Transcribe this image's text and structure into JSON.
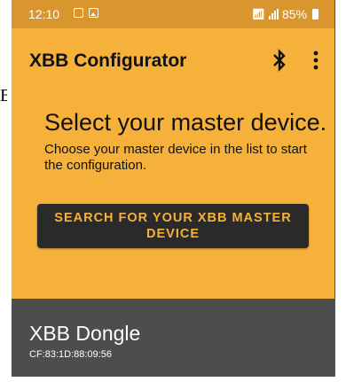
{
  "status_bar": {
    "time": "12:10",
    "battery": "85%"
  },
  "app_bar": {
    "title": "XBB Configurator"
  },
  "main": {
    "headline": "Select your master device.",
    "subtext": "Choose your master device in the list to start the configuration.",
    "search_button_label": "SEARCH FOR YOUR XBB MASTER DEVICE"
  },
  "devices": [
    {
      "name": "XBB Dongle",
      "mac": "CF:83:1D:88:09:56"
    }
  ],
  "margin_text": "B",
  "colors": {
    "accent": "#f6b13a",
    "status_bar": "#d9962f",
    "button_bg": "#2a2a2a",
    "list_bg": "#4d4d4d"
  },
  "icons": [
    "sim-icon",
    "image-icon",
    "wifi-icon",
    "signal-icon",
    "battery-icon",
    "bluetooth-icon",
    "more-vert-icon"
  ]
}
